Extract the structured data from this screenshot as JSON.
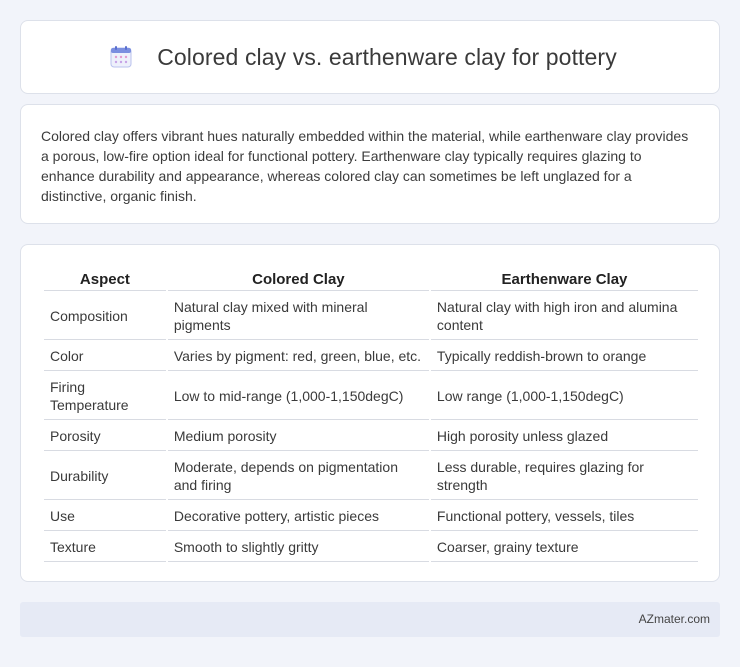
{
  "header": {
    "title": "Colored clay vs. earthenware clay for pottery",
    "icon": "calendar-icon"
  },
  "intro": {
    "text": "Colored clay offers vibrant hues naturally embedded within the material, while earthenware clay provides a porous, low-fire option ideal for functional pottery. Earthenware clay typically requires glazing to enhance durability and appearance, whereas colored clay can sometimes be left unglazed for a distinctive, organic finish."
  },
  "table": {
    "headers": [
      "Aspect",
      "Colored Clay",
      "Earthenware Clay"
    ],
    "rows": [
      [
        "Composition",
        "Natural clay mixed with mineral pigments",
        "Natural clay with high iron and alumina content"
      ],
      [
        "Color",
        "Varies by pigment: red, green, blue, etc.",
        "Typically reddish-brown to orange"
      ],
      [
        "Firing Temperature",
        "Low to mid-range (1,000-1,150degC)",
        "Low range (1,000-1,150degC)"
      ],
      [
        "Porosity",
        "Medium porosity",
        "High porosity unless glazed"
      ],
      [
        "Durability",
        "Moderate, depends on pigmentation and firing",
        "Less durable, requires glazing for strength"
      ],
      [
        "Use",
        "Decorative pottery, artistic pieces",
        "Functional pottery, vessels, tiles"
      ],
      [
        "Texture",
        "Smooth to slightly gritty",
        "Coarser, grainy texture"
      ]
    ]
  },
  "footer": {
    "brand": "AZmater.com"
  },
  "colors": {
    "background": "#f2f4fa",
    "card": "#ffffff",
    "footer": "#e6eaf5",
    "icon_accent": "#7b8fe0"
  }
}
